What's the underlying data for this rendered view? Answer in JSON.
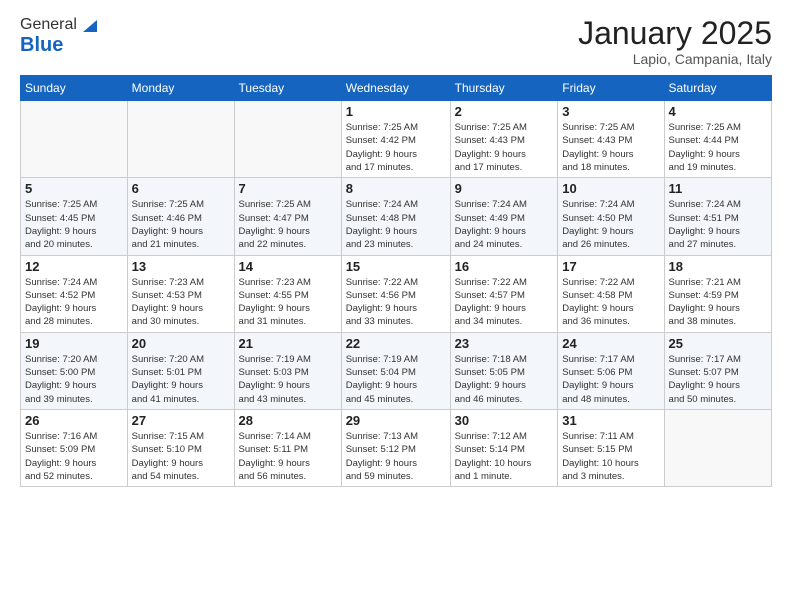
{
  "logo": {
    "line1": "General",
    "line2": "Blue",
    "triangle_color": "#1565c0"
  },
  "header": {
    "month": "January 2025",
    "location": "Lapio, Campania, Italy"
  },
  "weekdays": [
    "Sunday",
    "Monday",
    "Tuesday",
    "Wednesday",
    "Thursday",
    "Friday",
    "Saturday"
  ],
  "weeks": [
    [
      {
        "day": "",
        "info": ""
      },
      {
        "day": "",
        "info": ""
      },
      {
        "day": "",
        "info": ""
      },
      {
        "day": "1",
        "info": "Sunrise: 7:25 AM\nSunset: 4:42 PM\nDaylight: 9 hours\nand 17 minutes."
      },
      {
        "day": "2",
        "info": "Sunrise: 7:25 AM\nSunset: 4:43 PM\nDaylight: 9 hours\nand 17 minutes."
      },
      {
        "day": "3",
        "info": "Sunrise: 7:25 AM\nSunset: 4:43 PM\nDaylight: 9 hours\nand 18 minutes."
      },
      {
        "day": "4",
        "info": "Sunrise: 7:25 AM\nSunset: 4:44 PM\nDaylight: 9 hours\nand 19 minutes."
      }
    ],
    [
      {
        "day": "5",
        "info": "Sunrise: 7:25 AM\nSunset: 4:45 PM\nDaylight: 9 hours\nand 20 minutes."
      },
      {
        "day": "6",
        "info": "Sunrise: 7:25 AM\nSunset: 4:46 PM\nDaylight: 9 hours\nand 21 minutes."
      },
      {
        "day": "7",
        "info": "Sunrise: 7:25 AM\nSunset: 4:47 PM\nDaylight: 9 hours\nand 22 minutes."
      },
      {
        "day": "8",
        "info": "Sunrise: 7:24 AM\nSunset: 4:48 PM\nDaylight: 9 hours\nand 23 minutes."
      },
      {
        "day": "9",
        "info": "Sunrise: 7:24 AM\nSunset: 4:49 PM\nDaylight: 9 hours\nand 24 minutes."
      },
      {
        "day": "10",
        "info": "Sunrise: 7:24 AM\nSunset: 4:50 PM\nDaylight: 9 hours\nand 26 minutes."
      },
      {
        "day": "11",
        "info": "Sunrise: 7:24 AM\nSunset: 4:51 PM\nDaylight: 9 hours\nand 27 minutes."
      }
    ],
    [
      {
        "day": "12",
        "info": "Sunrise: 7:24 AM\nSunset: 4:52 PM\nDaylight: 9 hours\nand 28 minutes."
      },
      {
        "day": "13",
        "info": "Sunrise: 7:23 AM\nSunset: 4:53 PM\nDaylight: 9 hours\nand 30 minutes."
      },
      {
        "day": "14",
        "info": "Sunrise: 7:23 AM\nSunset: 4:55 PM\nDaylight: 9 hours\nand 31 minutes."
      },
      {
        "day": "15",
        "info": "Sunrise: 7:22 AM\nSunset: 4:56 PM\nDaylight: 9 hours\nand 33 minutes."
      },
      {
        "day": "16",
        "info": "Sunrise: 7:22 AM\nSunset: 4:57 PM\nDaylight: 9 hours\nand 34 minutes."
      },
      {
        "day": "17",
        "info": "Sunrise: 7:22 AM\nSunset: 4:58 PM\nDaylight: 9 hours\nand 36 minutes."
      },
      {
        "day": "18",
        "info": "Sunrise: 7:21 AM\nSunset: 4:59 PM\nDaylight: 9 hours\nand 38 minutes."
      }
    ],
    [
      {
        "day": "19",
        "info": "Sunrise: 7:20 AM\nSunset: 5:00 PM\nDaylight: 9 hours\nand 39 minutes."
      },
      {
        "day": "20",
        "info": "Sunrise: 7:20 AM\nSunset: 5:01 PM\nDaylight: 9 hours\nand 41 minutes."
      },
      {
        "day": "21",
        "info": "Sunrise: 7:19 AM\nSunset: 5:03 PM\nDaylight: 9 hours\nand 43 minutes."
      },
      {
        "day": "22",
        "info": "Sunrise: 7:19 AM\nSunset: 5:04 PM\nDaylight: 9 hours\nand 45 minutes."
      },
      {
        "day": "23",
        "info": "Sunrise: 7:18 AM\nSunset: 5:05 PM\nDaylight: 9 hours\nand 46 minutes."
      },
      {
        "day": "24",
        "info": "Sunrise: 7:17 AM\nSunset: 5:06 PM\nDaylight: 9 hours\nand 48 minutes."
      },
      {
        "day": "25",
        "info": "Sunrise: 7:17 AM\nSunset: 5:07 PM\nDaylight: 9 hours\nand 50 minutes."
      }
    ],
    [
      {
        "day": "26",
        "info": "Sunrise: 7:16 AM\nSunset: 5:09 PM\nDaylight: 9 hours\nand 52 minutes."
      },
      {
        "day": "27",
        "info": "Sunrise: 7:15 AM\nSunset: 5:10 PM\nDaylight: 9 hours\nand 54 minutes."
      },
      {
        "day": "28",
        "info": "Sunrise: 7:14 AM\nSunset: 5:11 PM\nDaylight: 9 hours\nand 56 minutes."
      },
      {
        "day": "29",
        "info": "Sunrise: 7:13 AM\nSunset: 5:12 PM\nDaylight: 9 hours\nand 59 minutes."
      },
      {
        "day": "30",
        "info": "Sunrise: 7:12 AM\nSunset: 5:14 PM\nDaylight: 10 hours\nand 1 minute."
      },
      {
        "day": "31",
        "info": "Sunrise: 7:11 AM\nSunset: 5:15 PM\nDaylight: 10 hours\nand 3 minutes."
      },
      {
        "day": "",
        "info": ""
      }
    ]
  ]
}
